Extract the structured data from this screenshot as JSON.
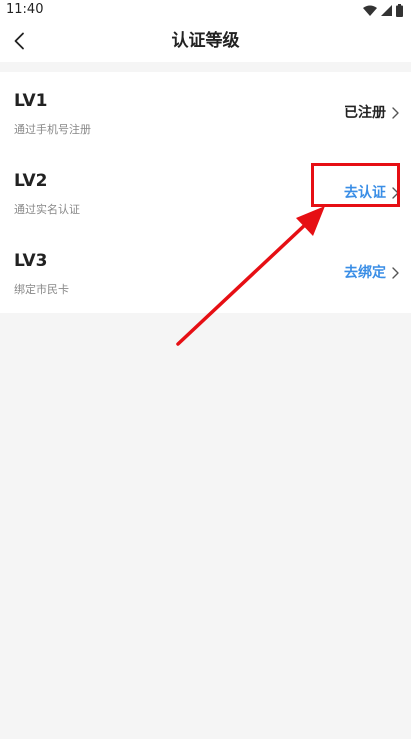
{
  "status_bar": {
    "time": "11:40"
  },
  "header": {
    "title": "认证等级"
  },
  "levels": [
    {
      "title": "LV1",
      "subtitle": "通过手机号注册",
      "action": "已注册",
      "state": "done"
    },
    {
      "title": "LV2",
      "subtitle": "通过实名认证",
      "action": "去认证",
      "state": "todo"
    },
    {
      "title": "LV3",
      "subtitle": "绑定市民卡",
      "action": "去绑定",
      "state": "todo"
    }
  ],
  "colors": {
    "done": "#222222",
    "todo": "#3a8ee6",
    "chevron": "#555555",
    "annotation": "#e60f14"
  },
  "icons": {
    "back": "chevron-left-icon",
    "action_chevron": "chevron-right-icon"
  }
}
